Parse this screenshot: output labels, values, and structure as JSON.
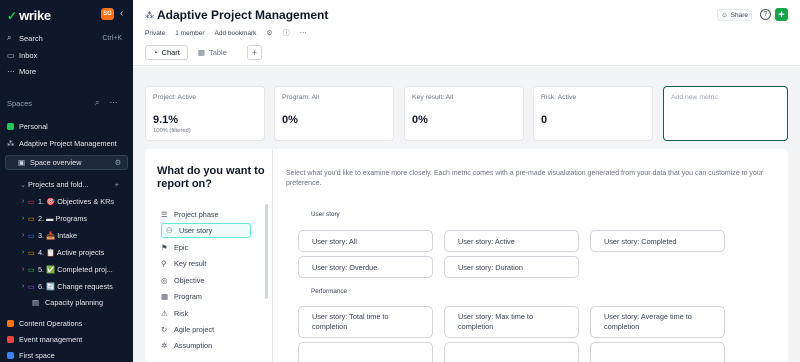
{
  "sidebar": {
    "logo": "wrike",
    "user_initials": "SG",
    "search_label": "Search",
    "search_shortcut": "Ctrl+K",
    "inbox_label": "Inbox",
    "more_label": "More",
    "spaces_label": "Spaces",
    "items": [
      {
        "label": "Personal"
      },
      {
        "label": "Adaptive Project Management"
      },
      {
        "label": "Space overview"
      },
      {
        "label": "Projects and fold..."
      },
      {
        "label": "1. 🎯 Objectives & KRs"
      },
      {
        "label": "2. ▬ Programs"
      },
      {
        "label": "3. 📥 Intake"
      },
      {
        "label": "4. 📋 Active projects"
      },
      {
        "label": "5. ✅ Completed proj..."
      },
      {
        "label": "6. 🔄 Change requests"
      },
      {
        "label": "Capacity planning"
      },
      {
        "label": "Content Operations"
      },
      {
        "label": "Event management"
      },
      {
        "label": "First space"
      }
    ]
  },
  "header": {
    "title": "Adaptive Project Management",
    "privacy": "Private",
    "members": "1 member",
    "bookmark": "Add bookmark",
    "share": "Share",
    "tabs": [
      {
        "label": "Chart"
      },
      {
        "label": "Table"
      }
    ]
  },
  "metrics": [
    {
      "label": "Project: Active",
      "value": "9.1%",
      "sub": "100% (filtered)"
    },
    {
      "label": "Program: All",
      "value": "0%",
      "sub": ""
    },
    {
      "label": "Key result: All",
      "value": "0%",
      "sub": ""
    },
    {
      "label": "Risk: Active",
      "value": "0",
      "sub": ""
    },
    {
      "label": "Add new metric",
      "value": "",
      "sub": ""
    }
  ],
  "report": {
    "heading": "What do you want to report on?",
    "description": "Select what you'd like to examine more closely. Each metric comes with a pre-made visualization generated from your data that you can customize to your preference.",
    "types": [
      {
        "label": "Project phase"
      },
      {
        "label": "User story"
      },
      {
        "label": "Epic"
      },
      {
        "label": "Key result"
      },
      {
        "label": "Objective"
      },
      {
        "label": "Program"
      },
      {
        "label": "Risk"
      },
      {
        "label": "Agile project"
      },
      {
        "label": "Assumption"
      }
    ],
    "section_user_story": "User story",
    "section_performance": "Performance",
    "user_story_metrics": [
      {
        "label": "User story: All"
      },
      {
        "label": "User story: Active"
      },
      {
        "label": "User story: Completed"
      },
      {
        "label": "User story: Overdue"
      },
      {
        "label": "User story: Duration"
      }
    ],
    "performance_metrics": [
      {
        "label": "User story: Total time to completion"
      },
      {
        "label": "User story: Max time to completion"
      },
      {
        "label": "User story: Average time to completion"
      }
    ]
  }
}
